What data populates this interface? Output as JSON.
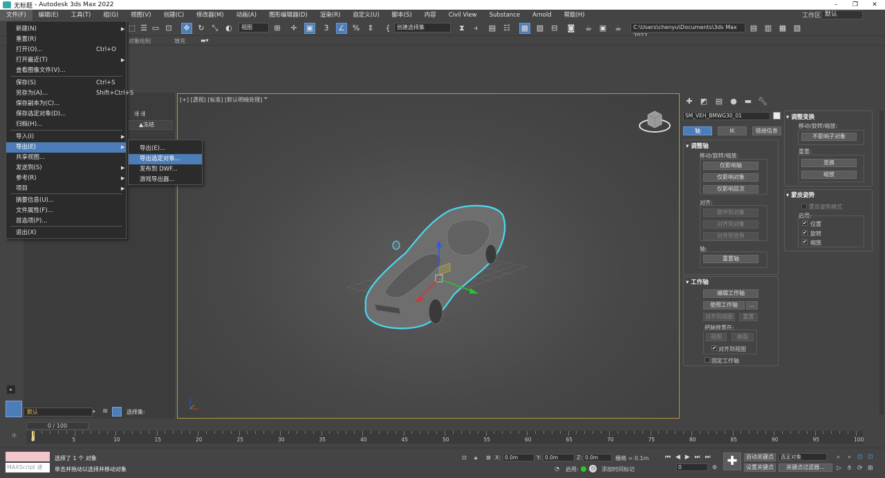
{
  "title": {
    "doc": "无标题",
    "app": "Autodesk 3ds Max 2022"
  },
  "menu": [
    "文件(F)",
    "编辑(E)",
    "工具(T)",
    "组(G)",
    "视图(V)",
    "创建(C)",
    "修改器(M)",
    "动画(A)",
    "图形编辑器(D)",
    "渲染(R)",
    "自定义(U)",
    "脚本(S)",
    "内容",
    "Civil View",
    "Substance",
    "Arnold",
    "帮助(H)"
  ],
  "workspace": {
    "label": "工作区:",
    "value": "默认"
  },
  "toolbar": {
    "view_select": "视图",
    "selection_set": "创建选择集",
    "project_path": "C:\\Users\\chenyu\\Documents\\3ds Max 2022"
  },
  "ribbon": {
    "object_paint": "对象绘制",
    "fill": "填充"
  },
  "file_menu": [
    {
      "label": "新建(N)",
      "shortcut": "",
      "arrow": true
    },
    {
      "label": "重置(R)",
      "shortcut": "",
      "arrow": false
    },
    {
      "label": "打开(O)...",
      "shortcut": "Ctrl+O",
      "arrow": false
    },
    {
      "label": "打开最近(T)",
      "shortcut": "",
      "arrow": true
    },
    {
      "label": "查看图像文件(V)...",
      "shortcut": "",
      "arrow": false
    },
    {
      "label": "保存(S)",
      "shortcut": "Ctrl+S",
      "arrow": false
    },
    {
      "label": "另存为(A)...",
      "shortcut": "Shift+Ctrl+S",
      "arrow": false
    },
    {
      "label": "保存副本为(C)...",
      "shortcut": "",
      "arrow": false
    },
    {
      "label": "保存选定对象(D)...",
      "shortcut": "",
      "arrow": false
    },
    {
      "label": "归档(H)...",
      "shortcut": "",
      "arrow": false
    },
    {
      "label": "导入(I)",
      "shortcut": "",
      "arrow": true
    },
    {
      "label": "导出(E)",
      "shortcut": "",
      "arrow": true
    },
    {
      "label": "共享视图...",
      "shortcut": "",
      "arrow": false
    },
    {
      "label": "发送到(S)",
      "shortcut": "",
      "arrow": true
    },
    {
      "label": "参考(R)",
      "shortcut": "",
      "arrow": true
    },
    {
      "label": "项目",
      "shortcut": "",
      "arrow": true
    },
    {
      "label": "摘要信息(U)...",
      "shortcut": "",
      "arrow": false
    },
    {
      "label": "文件属性(F)...",
      "shortcut": "",
      "arrow": false
    },
    {
      "label": "首选项(P)...",
      "shortcut": "",
      "arrow": false
    },
    {
      "label": "退出(X)",
      "shortcut": "",
      "arrow": false
    }
  ],
  "export_submenu": [
    "导出(E)...",
    "导出选定对象...",
    "发布到 DWF...",
    "游戏导出器..."
  ],
  "scene_explorer": {
    "freeze_col": "▲冻结",
    "layer_value": "默认",
    "selection_set_label": "选择集:"
  },
  "viewport": {
    "labels": "[+] [透视] [标准] [默认明暗处理]"
  },
  "command_panel": {
    "object_name": "SM_VEH_BMWG30_01",
    "tabs": [
      "轴",
      "IK",
      "链接信息"
    ],
    "adjust_pivot": {
      "title": "调整轴",
      "move_rotate_scale": "移动/旋转/缩放:",
      "affect_pivot_only": "仅影响轴",
      "affect_object_only": "仅影响对象",
      "affect_hierarchy_only": "仅影响层次",
      "align": "对齐:",
      "center_to_object": "居中到对象",
      "align_to_object": "对齐到对象",
      "align_to_world": "对齐到世界",
      "pivot": "轴:",
      "reset_pivot": "重置轴"
    },
    "working_pivot": {
      "title": "工作轴",
      "edit_working_pivot": "编辑工作轴",
      "use_working_pivot": "使用工作轴",
      "more": "...",
      "align_to_view": "对齐到视图",
      "reset": "重置",
      "place_pivot_to": "把轴放置在:",
      "view": "视图",
      "surface": "曲面",
      "align_to_view_chk": "对齐到视图",
      "lock_working_pivot": "固定工作轴"
    },
    "adjust_transform": {
      "title": "调整变换",
      "move_rotate_scale": "移动/旋转/缩放:",
      "dont_affect_children": "不影响子对象",
      "reset": "重置:",
      "transform": "变换",
      "scale": "缩放"
    },
    "skin_pose": {
      "title": "蒙皮姿势",
      "skin_pose_mode": "蒙皮姿势模式",
      "enabled": "启用:",
      "position": "位置",
      "rotation": "旋转",
      "scale": "缩放"
    }
  },
  "timeline": {
    "slider_label": "0 / 100",
    "ticks": [
      "0",
      "5",
      "10",
      "15",
      "20",
      "25",
      "30",
      "35",
      "40",
      "45",
      "50",
      "55",
      "60",
      "65",
      "70",
      "75",
      "80",
      "85",
      "90",
      "95",
      "100"
    ]
  },
  "status": {
    "maxscript": "MAXScript 迷",
    "selected": "选择了 1 个 对象",
    "prompt": "单击并拖动以选择并移动对象",
    "x_label": "X:",
    "x": "0.0m",
    "y_label": "Y:",
    "y": "0.0m",
    "z_label": "Z:",
    "z": "0.0m",
    "grid": "栅格 = 0.1m",
    "enabled": "启用:",
    "add_time_tag": "添加时间标记",
    "auto_key": "自动关键点",
    "set_key": "设置关键点",
    "selected_obj": "选定对象",
    "key_filters": "关键点过滤器...",
    "frame": "0"
  }
}
